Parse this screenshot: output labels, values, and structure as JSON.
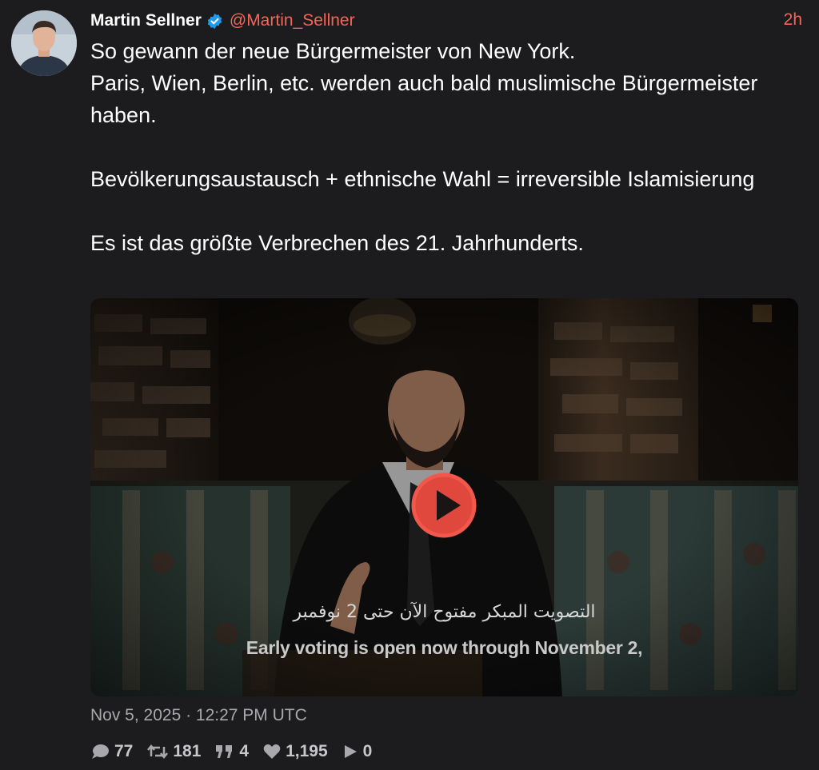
{
  "tweet": {
    "author_name": "Martin Sellner",
    "handle": "@Martin_Sellner",
    "time_ago": "2h",
    "text": "So gewann der neue Bürgermeister von New York.\nParis, Wien, Berlin, etc. werden auch bald muslimische Bürgermeister haben.\n\nBevölkerungsaustausch + ethnische Wahl = irreversible Islamisierung\n\nEs ist das größte Verbrechen des 21. Jahrhunderts.",
    "timestamp": "Nov 5, 2025 · 12:27 PM UTC"
  },
  "media": {
    "subtitle_ar": "التصويت المبكر مفتوح الآن حتى 2 نوفمبر",
    "subtitle_en": "Early voting is open now through November 2,"
  },
  "actions": {
    "replies": "77",
    "retweets": "181",
    "quotes": "4",
    "likes": "1,195",
    "views": "0"
  },
  "colors": {
    "background": "#1c1c1e",
    "accent": "#f56558",
    "verified": "#1d9bf0",
    "muted": "#a8a8ad"
  },
  "icons": [
    "verified-badge-icon",
    "play-icon",
    "reply-icon",
    "retweet-icon",
    "quote-icon",
    "heart-icon",
    "views-icon"
  ]
}
